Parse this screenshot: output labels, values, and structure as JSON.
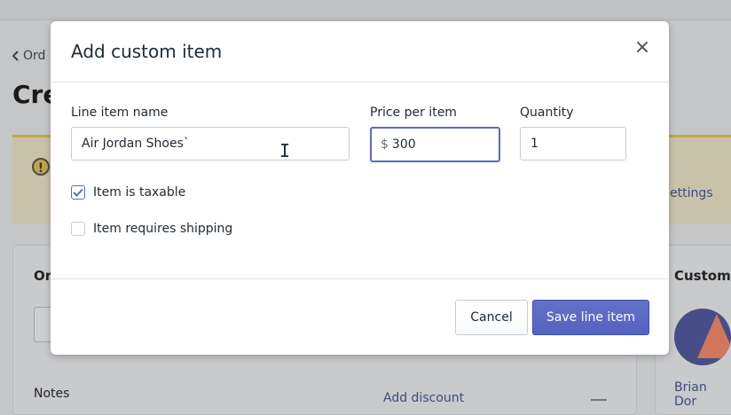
{
  "background": {
    "back_link": "Ord",
    "page_title": "Cre",
    "banner_link": "ettings",
    "order_card_title": "Or",
    "notes_label": "Notes",
    "add_discount": "Add discount",
    "customer_card_title": "Custom",
    "customer_name": "Brian Dor",
    "banner_icon": "!"
  },
  "modal": {
    "title": "Add custom item",
    "close_icon": "×",
    "fields": {
      "line_item_name": {
        "label": "Line item name",
        "value": "Air Jordan Shoes`"
      },
      "price_per_item": {
        "label": "Price per item",
        "prefix": "$",
        "value": "300"
      },
      "quantity": {
        "label": "Quantity",
        "value": "1"
      }
    },
    "checkboxes": {
      "taxable": {
        "label": "Item is taxable",
        "checked": true
      },
      "shipping": {
        "label": "Item requires shipping",
        "checked": false
      }
    },
    "buttons": {
      "cancel": "Cancel",
      "save": "Save line item"
    }
  },
  "colors": {
    "accent": "#5c6ac4",
    "banner": "#c9a53a"
  }
}
